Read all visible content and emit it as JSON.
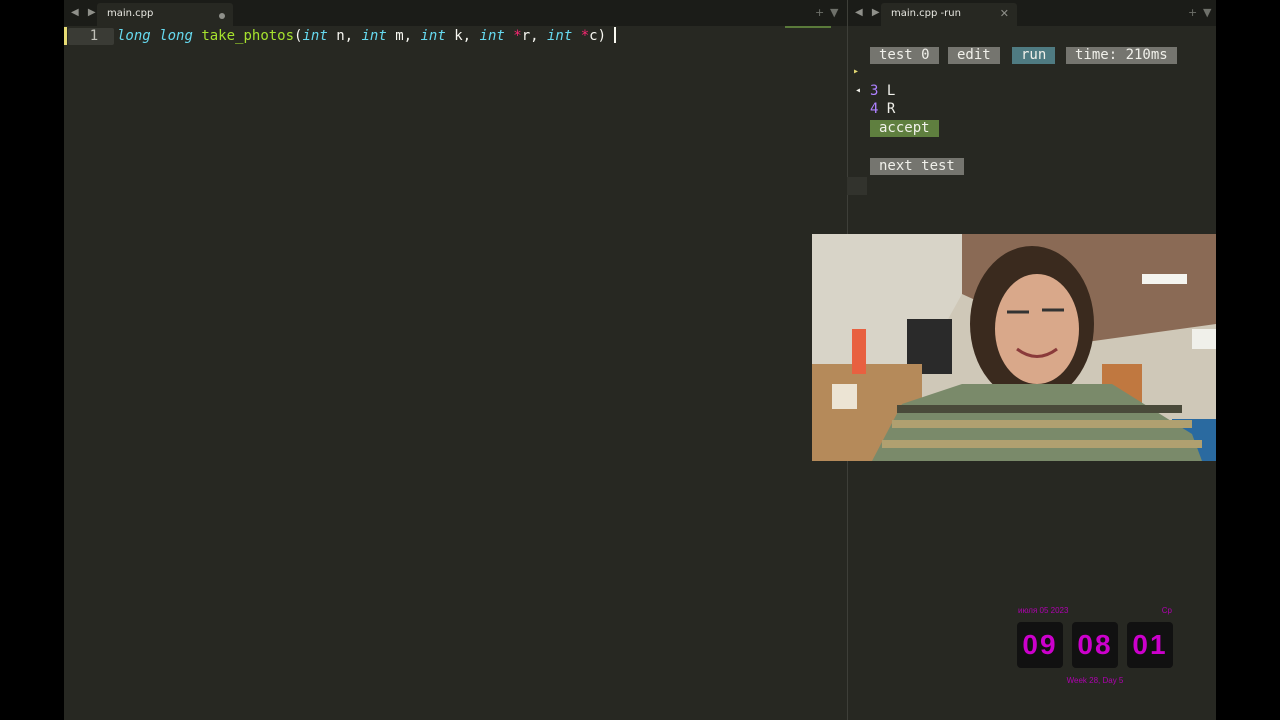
{
  "editor": {
    "tab_label": "main.cpp",
    "line_number": "1",
    "code_tokens": [
      {
        "t": "long",
        "c": "kw"
      },
      {
        "t": " ",
        "c": ""
      },
      {
        "t": "long",
        "c": "kw"
      },
      {
        "t": " ",
        "c": ""
      },
      {
        "t": "take_photos",
        "c": "fn"
      },
      {
        "t": "(",
        "c": ""
      },
      {
        "t": "int",
        "c": "kw"
      },
      {
        "t": " n, ",
        "c": ""
      },
      {
        "t": "int",
        "c": "kw"
      },
      {
        "t": " m, ",
        "c": ""
      },
      {
        "t": "int",
        "c": "kw"
      },
      {
        "t": " k, ",
        "c": ""
      },
      {
        "t": "int",
        "c": "kw"
      },
      {
        "t": " ",
        "c": ""
      },
      {
        "t": "*",
        "c": "op"
      },
      {
        "t": "r, ",
        "c": ""
      },
      {
        "t": "int",
        "c": "kw"
      },
      {
        "t": " ",
        "c": ""
      },
      {
        "t": "*",
        "c": "op"
      },
      {
        "t": "c)",
        "c": ""
      }
    ]
  },
  "run_panel": {
    "tab_label": "main.cpp -run",
    "buttons": {
      "test": "test 0",
      "edit": "edit",
      "run": "run",
      "time": "time: 210ms"
    },
    "output_lines": [
      {
        "num": "3",
        "text": "L"
      },
      {
        "num": "4",
        "text": "R"
      }
    ],
    "verdict": "accept",
    "next_test": "next test"
  },
  "colors": {
    "editor_bg": "#272822",
    "pill_gray": "#75756f",
    "pill_run": "#4f7b82",
    "pill_accept": "#5f7f3f",
    "clock": "#cc00cc"
  },
  "clock": {
    "date": "июля 05 2023",
    "weekday": "Ср",
    "hours": "09",
    "minutes": "08",
    "seconds": "01",
    "week": "Week 28, Day 5"
  }
}
